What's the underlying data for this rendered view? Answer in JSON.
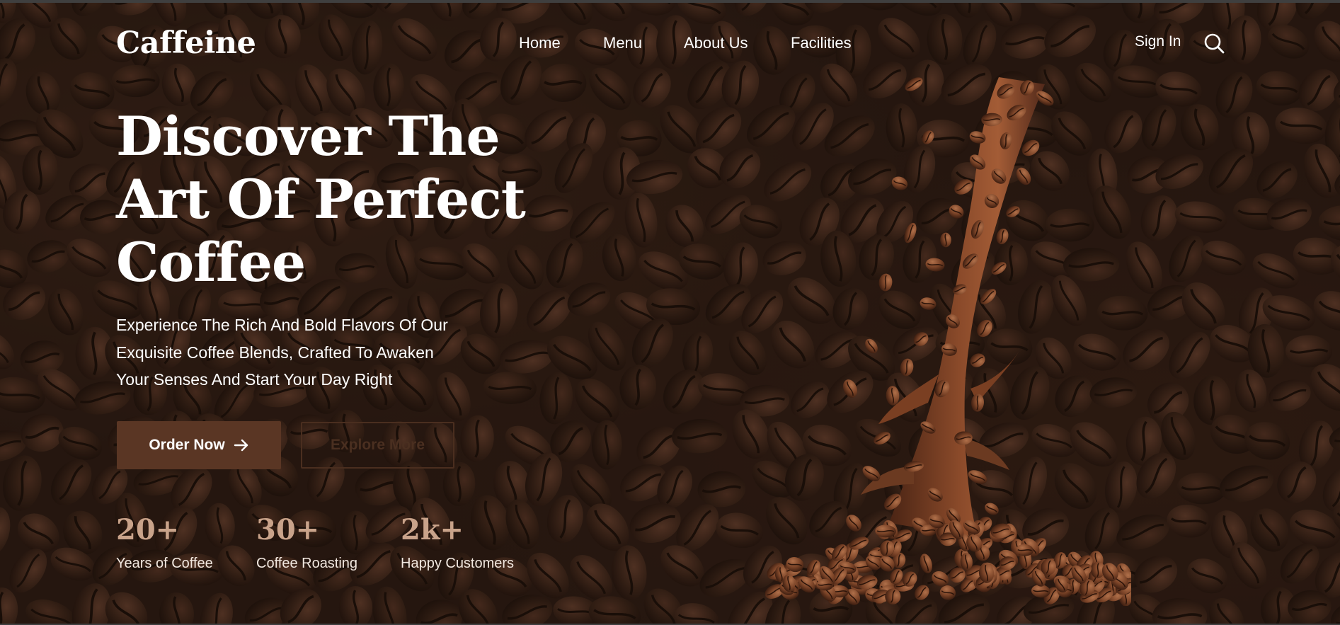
{
  "brand": {
    "logo_text": "Caffeine"
  },
  "nav": {
    "items": [
      {
        "label": "Home"
      },
      {
        "label": "Menu"
      },
      {
        "label": "About Us"
      },
      {
        "label": "Facilities"
      }
    ],
    "sign_in_label": "Sign In",
    "search_icon": "search-icon"
  },
  "hero": {
    "headline_lines": [
      "Discover The",
      "Art Of Perfect",
      "Coffee"
    ],
    "subtext_lines": [
      "Experience The Rich And Bold Flavors Of Our",
      "Exquisite Coffee Blends, Crafted To Awaken",
      "Your Senses And Start Your Day Right"
    ],
    "order_button_label": "Order Now",
    "order_button_icon": "arrow-right-icon",
    "explore_button_label": "Explore More"
  },
  "stats": [
    {
      "value": "20+",
      "label": "Years of Coffee"
    },
    {
      "value": "30+",
      "label": "Coffee Roasting"
    },
    {
      "value": "2k+",
      "label": "Happy Customers"
    }
  ],
  "colors": {
    "background": "#2b1b13",
    "accent_button": "#5a3624",
    "stat_number": "#c9a38a",
    "text": "#ffffff"
  }
}
